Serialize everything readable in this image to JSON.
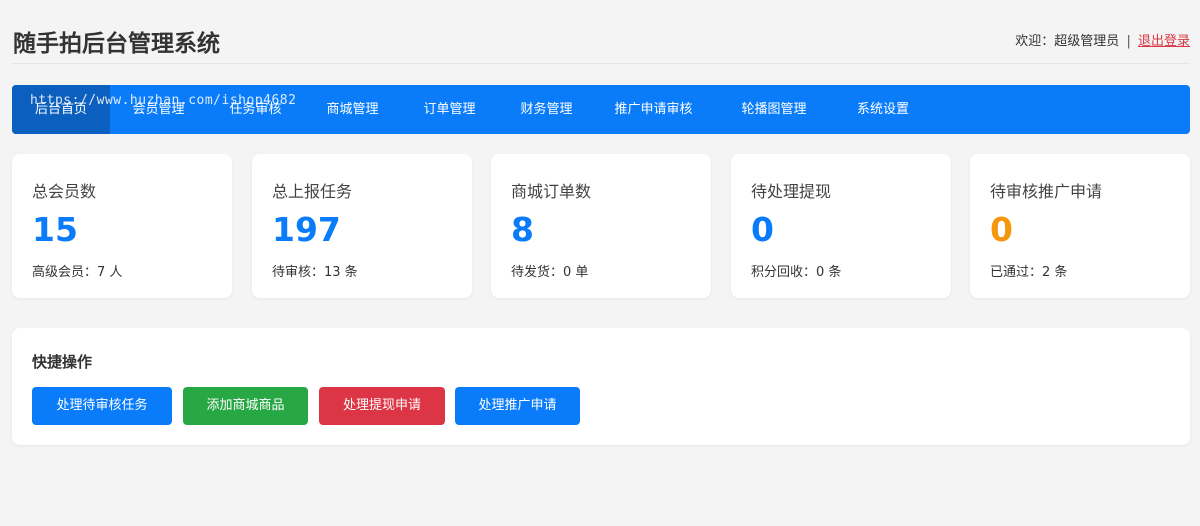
{
  "header": {
    "title": "随手拍后台管理系统",
    "welcome": "欢迎：超级管理员",
    "separator": "|",
    "logout": "退出登录"
  },
  "watermark": "https://www.huzhan.com/ishop4682",
  "nav": {
    "items": [
      {
        "label": "后台首页",
        "active": true
      },
      {
        "label": "会员管理"
      },
      {
        "label": "任务审核"
      },
      {
        "label": "商城管理"
      },
      {
        "label": "订单管理"
      },
      {
        "label": "财务管理"
      },
      {
        "label": "推广申请审核"
      },
      {
        "label": "轮播图管理"
      },
      {
        "label": "系统设置"
      }
    ]
  },
  "stats": [
    {
      "label": "总会员数",
      "value": "15",
      "sub": "高级会员：7 人",
      "color": "#0a7cfa"
    },
    {
      "label": "总上报任务",
      "value": "197",
      "sub": "待审核：13 条",
      "color": "#0a7cfa"
    },
    {
      "label": "商城订单数",
      "value": "8",
      "sub": "待发货：0 单",
      "color": "#0a7cfa"
    },
    {
      "label": "待处理提现",
      "value": "0",
      "sub": "积分回收：0 条",
      "color": "#0a7cfa"
    },
    {
      "label": "待审核推广申请",
      "value": "0",
      "sub": "已通过：2 条",
      "color": "#f5960b"
    }
  ],
  "quick": {
    "title": "快捷操作",
    "buttons": [
      {
        "label": "处理待审核任务",
        "color": "#0a7cfa"
      },
      {
        "label": "添加商城商品",
        "color": "#28a745"
      },
      {
        "label": "处理提现申请",
        "color": "#dc3545"
      },
      {
        "label": "处理推广申请",
        "color": "#0a7cfa"
      }
    ]
  }
}
